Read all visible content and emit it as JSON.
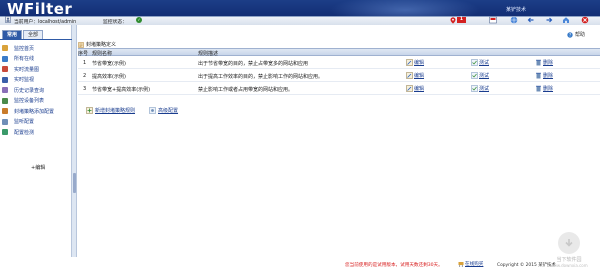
{
  "header": {
    "logo": "WFilter",
    "product": "某铲技术",
    "user_label": "当前用户：localhost/admin",
    "status_label": "监控状态：",
    "alert_count": "1",
    "toolbar_icons": [
      "alert-icon",
      "refresh-icon",
      "globe-icon",
      "back-icon",
      "forward-icon",
      "home-icon",
      "logout-icon"
    ],
    "brand_color": "#143077"
  },
  "sidebar": {
    "tabs": [
      {
        "label": "常用",
        "active": true
      },
      {
        "label": "全部",
        "active": false
      }
    ],
    "items": [
      {
        "label": "监控首页",
        "icon": "home-icon",
        "color": "#d9a23a"
      },
      {
        "label": "所有在线",
        "icon": "users-icon",
        "color": "#3a7cc9"
      },
      {
        "label": "实时流量图",
        "icon": "chart-icon",
        "color": "#c94a3a"
      },
      {
        "label": "实时监视",
        "icon": "monitor-icon",
        "color": "#3a5fa9"
      },
      {
        "label": "历史记录查询",
        "icon": "history-icon",
        "color": "#8a6fb8"
      },
      {
        "label": "监控设备列表",
        "icon": "device-list-icon",
        "color": "#4b8a4b"
      },
      {
        "label": "封堵策略添加配置",
        "icon": "policy-icon",
        "color": "#c97b2a"
      },
      {
        "label": "监听配置",
        "icon": "settings-icon",
        "color": "#6f8fb8"
      },
      {
        "label": "配置检测",
        "icon": "check-icon",
        "color": "#3a9a6a"
      }
    ],
    "add_edit": "+编辑"
  },
  "main": {
    "help_label": "帮助",
    "section_title": "封堵策略定义",
    "columns": {
      "index": "序号",
      "name": "规则名称",
      "desc": "规则描述"
    },
    "rows": [
      {
        "index": "1",
        "name": "节省带宽(示例)",
        "desc": "出于节省带宽的目的，禁止占带宽多的网站和应用",
        "edit": "编辑",
        "test": "测试",
        "delete": "删除"
      },
      {
        "index": "2",
        "name": "提高效率(示例)",
        "desc": "出于提高工作效率的目的，禁止影响工作的网站和应用。",
        "edit": "编辑",
        "test": "测试",
        "delete": "删除"
      },
      {
        "index": "3",
        "name": "节省带宽+提高效率(示例)",
        "desc": "禁止影响工作或者占用带宽的网站和应用。",
        "edit": "编辑",
        "test": "测试",
        "delete": "删除"
      }
    ],
    "new_rule": "新增封堵策略规则",
    "advanced": "高级配置"
  },
  "statusbar": {
    "trial_text": "您当前使用的是试用版本，试用天数还剩30天。",
    "purchase_link": "在线购买",
    "copyright": "Copyright © 2015  某铲技术",
    "accent_color": "#d81f1f"
  },
  "watermark": {
    "title": "当下软件园",
    "subtitle": "www.downxia.com"
  }
}
